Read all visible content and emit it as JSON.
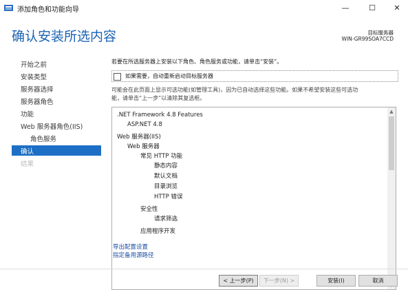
{
  "window": {
    "title": "添加角色和功能向导",
    "minimize_glyph": "—",
    "maximize_glyph": "☐",
    "close_glyph": "✕",
    "app_icon": "server-manager-icon"
  },
  "header": {
    "title": "确认安装所选内容",
    "destination_label": "目标服务器",
    "destination_server": "WIN-GR99SOA7CCD"
  },
  "nav": {
    "items": [
      {
        "label": "开始之前",
        "state": "normal"
      },
      {
        "label": "安装类型",
        "state": "normal"
      },
      {
        "label": "服务器选择",
        "state": "normal"
      },
      {
        "label": "服务器角色",
        "state": "normal"
      },
      {
        "label": "功能",
        "state": "normal"
      },
      {
        "label": "Web 服务器角色(IIS)",
        "state": "normal"
      },
      {
        "label": "角色服务",
        "state": "sub"
      },
      {
        "label": "确认",
        "state": "active"
      },
      {
        "label": "结果",
        "state": "disabled"
      }
    ]
  },
  "main": {
    "intro": "若要在所选服务器上安装以下角色、角色服务或功能，请单击“安装”。",
    "restart_checkbox": {
      "label": "如果需要，自动重新启动目标服务器",
      "checked": false
    },
    "note_line1": "可能会在此页面上显示可选功能(如管理工具)，因为已自动选择这些功能。如果不希望安装这些可选功",
    "note_line2": "能，请单击“上一步”以清除其复选框。",
    "features": [
      {
        "text": ".NET Framework 4.8 Features",
        "level": 0
      },
      {
        "text": "ASP.NET 4.8",
        "level": 1
      },
      {
        "text": "Web 服务器(IIS)",
        "level": 0
      },
      {
        "text": "Web 服务器",
        "level": 1
      },
      {
        "text": "常见 HTTP 功能",
        "level": 2
      },
      {
        "text": "静态内容",
        "level": 3
      },
      {
        "text": "默认文档",
        "level": 3
      },
      {
        "text": "目录浏览",
        "level": 3
      },
      {
        "text": "HTTP 错误",
        "level": 3
      },
      {
        "text": "安全性",
        "level": 2
      },
      {
        "text": "请求筛选",
        "level": 3
      },
      {
        "text": "应用程序开发",
        "level": 2
      }
    ],
    "scroll_up_glyph": "▲",
    "scroll_down_glyph": "▼",
    "export_link": "导出配置设置",
    "alt_source_link": "指定备用源路径"
  },
  "footer": {
    "prev": "< 上一步(P)",
    "next": "下一步(N) >",
    "install": "安装(I)",
    "cancel": "取消"
  }
}
